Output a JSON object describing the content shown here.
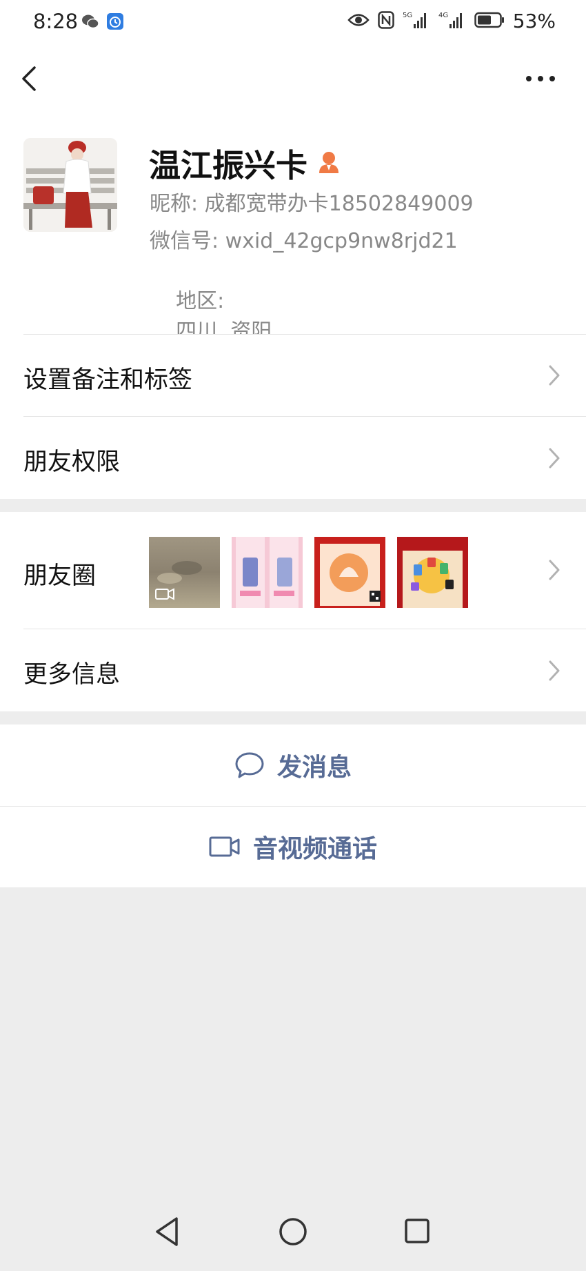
{
  "status_bar": {
    "time": "8:28",
    "battery": "53%",
    "icons": [
      "wechat-icon",
      "alarm-icon",
      "eye-icon",
      "nfc-icon",
      "5g-signal-icon",
      "4g-signal-icon",
      "battery-icon"
    ]
  },
  "profile": {
    "name": "温江振兴卡",
    "nickname_label": "昵称:",
    "nickname": "成都宽带办卡18502849009",
    "wechat_id_label": "微信号:",
    "wechat_id": "wxid_42gcp9nw8rjd21",
    "region_label": "地区:",
    "region": "四川  资阳"
  },
  "menu": {
    "remarks_tags": "设置备注和标签",
    "friend_permissions": "朋友权限",
    "moments": "朋友圈",
    "more_info": "更多信息"
  },
  "actions": {
    "send_message": "发消息",
    "video_call": "音视频通话"
  },
  "colors": {
    "link_blue": "#576b95",
    "background": "#ededed",
    "badge_orange": "#f07a45"
  }
}
